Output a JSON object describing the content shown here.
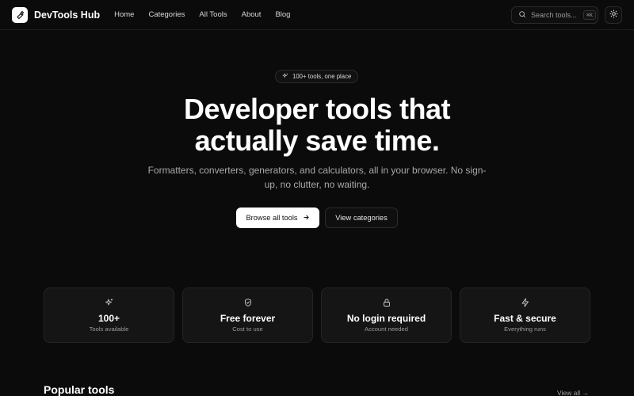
{
  "brand": {
    "name": "DevTools Hub",
    "logo_icon": "wrench-icon"
  },
  "nav": {
    "links": [
      "Home",
      "Categories",
      "All Tools",
      "About",
      "Blog"
    ]
  },
  "search": {
    "placeholder": "Search tools...",
    "shortcut": "⌘K"
  },
  "theme_toggle": {
    "icon": "sun-icon"
  },
  "hero": {
    "badge": "100+ tools, one place",
    "title_line1": "Developer tools that",
    "title_line2": "actually save time.",
    "subtitle": "Formatters, converters, generators, and calculators, all in your browser. No sign-up, no clutter, no waiting.",
    "primary_button": "Browse all tools",
    "secondary_button": "View categories"
  },
  "features": [
    {
      "icon": "sparkle-icon",
      "title": "100+",
      "subtitle": "Tools available"
    },
    {
      "icon": "shield-icon",
      "title": "Free forever",
      "subtitle": "Cost to use"
    },
    {
      "icon": "lock-icon",
      "title": "No login required",
      "subtitle": "Account needed"
    },
    {
      "icon": "bolt-icon",
      "title": "Fast & secure",
      "subtitle": "Everything runs"
    }
  ],
  "popular": {
    "title": "Popular tools",
    "view_all": "View all →"
  },
  "colors": {
    "background": "#0b0b0b",
    "accent": "#ffffff",
    "muted": "#a9a9a9"
  }
}
